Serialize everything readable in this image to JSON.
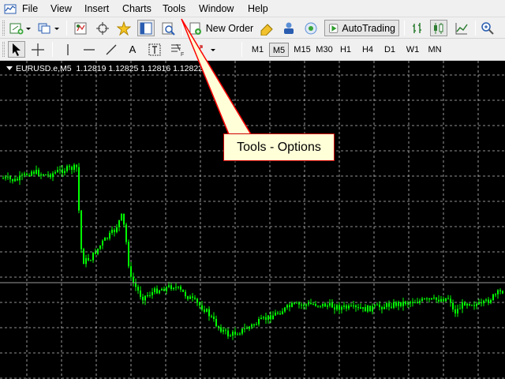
{
  "menu": {
    "items": [
      {
        "label": "File"
      },
      {
        "label": "View"
      },
      {
        "label": "Insert"
      },
      {
        "label": "Charts"
      },
      {
        "label": "Tools"
      },
      {
        "label": "Window"
      },
      {
        "label": "Help"
      }
    ]
  },
  "toolbar": {
    "new_order_label": "New Order",
    "autotrading_label": "AutoTrading",
    "icons": [
      "new-chart-icon",
      "profiles-icon",
      "market-watch-icon",
      "crosshair-icon",
      "favorites-icon",
      "navigator-icon",
      "terminal-icon",
      "new-order-icon",
      "metaeditor-icon",
      "signals-icon",
      "autotrading-icon",
      "bar-chart-icon",
      "candlestick-icon",
      "line-chart-icon",
      "zoom-in-icon"
    ]
  },
  "drawing_tools": {
    "icons": [
      "cursor-icon",
      "crosshair-icon",
      "vertical-line-icon",
      "horizontal-line-icon",
      "trendline-icon",
      "text-icon",
      "text-label-icon",
      "fibonacci-icon",
      "arrows-icon"
    ],
    "text_tool_label": "A"
  },
  "timeframes": [
    "M1",
    "M5",
    "M15",
    "M30",
    "H1",
    "H4",
    "D1",
    "W1",
    "MN"
  ],
  "active_timeframe": "M5",
  "chart": {
    "symbol": "EURUSD.e,M5",
    "ohlc": "1.12819 1.12825 1.12816 1.12822",
    "background": "#000000",
    "candle_color": "#00ff00",
    "grid_color": "#c0c0c0"
  },
  "callout": {
    "text": "Tools - Options",
    "background": "#ffffd8",
    "arrow_color": "#ff0000"
  }
}
